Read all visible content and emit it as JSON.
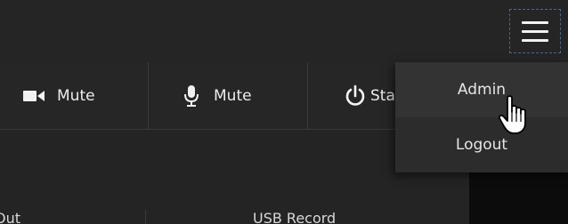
{
  "header": {
    "menu_icon": "hamburger-menu-icon"
  },
  "controls": [
    {
      "icon": "video-camera-icon",
      "label": "Mute"
    },
    {
      "icon": "microphone-icon",
      "label": "Mute"
    },
    {
      "icon": "power-icon",
      "label": "Sta"
    }
  ],
  "bottom_labels": {
    "left": "Out",
    "middle": "USB Record"
  },
  "menu": {
    "items": [
      {
        "label": "Admin",
        "state": "hover"
      },
      {
        "label": "Logout"
      }
    ]
  },
  "cursor": {
    "icon": "hand-pointer-cursor-icon"
  },
  "colors": {
    "background": "#222222",
    "menu_background": "#2c2c2c",
    "menu_hover": "#333333",
    "text": "#ececec",
    "focus_outline": "#4a6a8a"
  }
}
